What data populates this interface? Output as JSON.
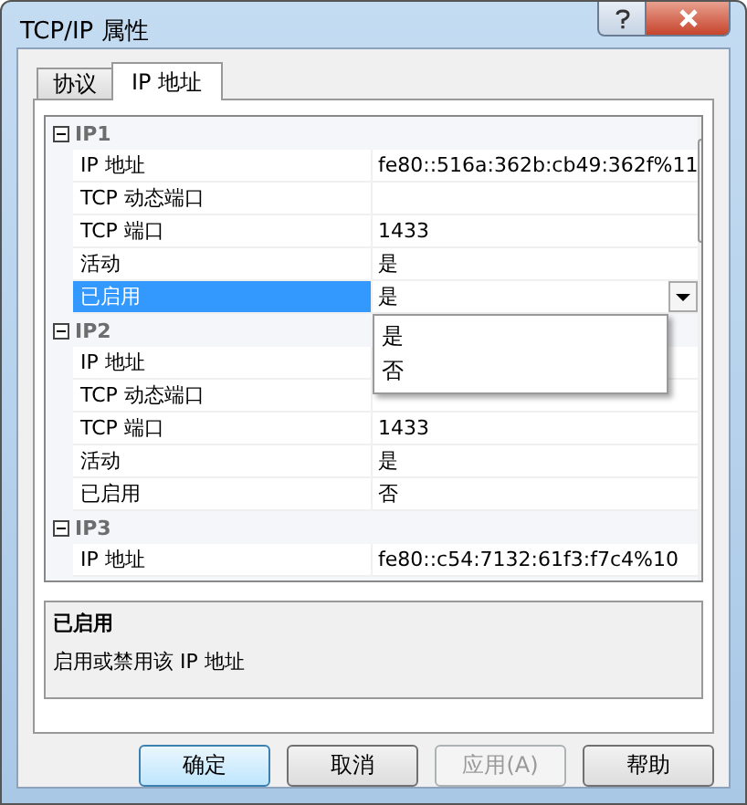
{
  "window": {
    "title": "TCP/IP 属性"
  },
  "tabs": [
    {
      "label": "协议",
      "selected": false
    },
    {
      "label": "IP 地址",
      "selected": true
    }
  ],
  "groups": [
    {
      "name": "IP1",
      "expanded": true,
      "properties": [
        {
          "name": "IP 地址",
          "value": "fe80::516a:362b:cb49:362f%11",
          "selected": false
        },
        {
          "name": "TCP 动态端口",
          "selected": false
        },
        {
          "name": "TCP 端口",
          "value": "1433",
          "selected": false
        },
        {
          "name": "活动",
          "value": "是",
          "selected": false
        },
        {
          "name": "已启用",
          "value": "是",
          "selected": true,
          "dropdown_open": true
        }
      ]
    },
    {
      "name": "IP2",
      "expanded": true,
      "properties": [
        {
          "name": "IP 地址",
          "selected": false
        },
        {
          "name": "TCP 动态端口",
          "selected": false
        },
        {
          "name": "TCP 端口",
          "value": "1433",
          "selected": false
        },
        {
          "name": "活动",
          "value": "是",
          "selected": false
        },
        {
          "name": "已启用",
          "value": "否",
          "selected": false
        }
      ]
    },
    {
      "name": "IP3",
      "expanded": true,
      "properties": [
        {
          "name": "IP 地址",
          "value": "fe80::c54:7132:61f3:f7c4%10",
          "selected": false
        }
      ]
    }
  ],
  "dropdown": {
    "options": [
      "是",
      "否"
    ]
  },
  "description": {
    "title": "已启用",
    "text": "启用或禁用该 IP 地址"
  },
  "buttons": [
    {
      "label": "确定",
      "kind": "default",
      "disabled": false
    },
    {
      "label": "取消",
      "kind": "normal",
      "disabled": false
    },
    {
      "label": "应用(A)",
      "kind": "normal",
      "disabled": true
    },
    {
      "label": "帮助",
      "kind": "normal",
      "disabled": false
    }
  ]
}
